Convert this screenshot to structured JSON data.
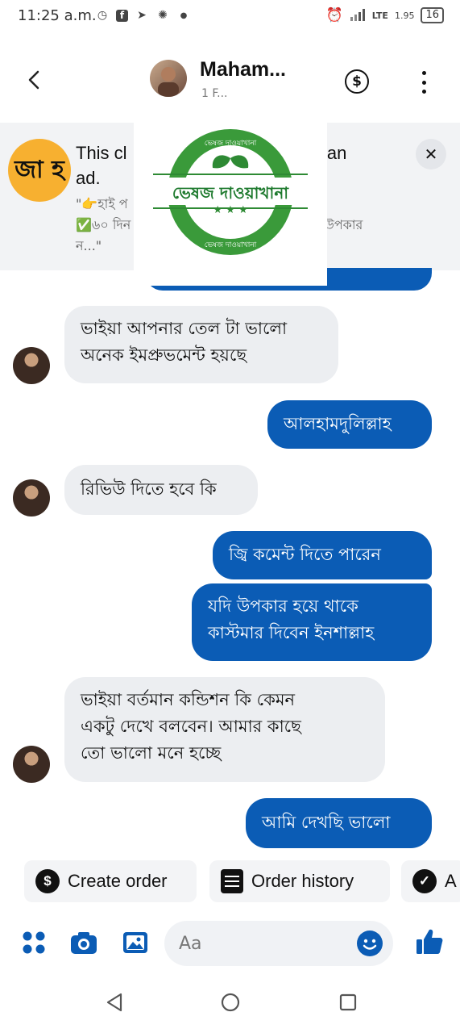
{
  "status_bar": {
    "time": "11:25 a.m.",
    "network": "LTE",
    "speed": "1.95",
    "battery": "16"
  },
  "header": {
    "contact_name": "Maham...",
    "subtitle": "1 F..."
  },
  "ad_banner": {
    "logo_text": "জা হ",
    "title": "This c[obscured] o an ad.",
    "title_left": "This cl",
    "title_right": "o an",
    "title_line2": "ad.",
    "snippet_line1": "\"👉হাই প",
    "snippet_line2": "✅৬০ দিন",
    "snippet_line2_right": "উপকার",
    "snippet_line3": "ন...\""
  },
  "overlay_logo": {
    "main_text": "ভেষজ দাওয়াখানা",
    "arc_text_top": "ভেষজ দাওয়াখানা",
    "arc_text_bottom": "ভেষজ দাওয়াখানা",
    "colors": {
      "green": "#3a9a3a",
      "dark_green": "#1e7a2e"
    }
  },
  "messages": [
    {
      "side": "in",
      "lines": [
        "ভাইয়া আপনার তেল টা ভালো",
        "অনেক ইমপ্রুভমেন্ট হয়ছে"
      ]
    },
    {
      "side": "out",
      "lines": [
        "আলহামদুলিল্লাহ"
      ]
    },
    {
      "side": "in",
      "lines": [
        "রিভিউ দিতে হবে কি"
      ]
    },
    {
      "side": "out",
      "lines": [
        "জ্বি কমেন্ট দিতে পারেন"
      ]
    },
    {
      "side": "out",
      "lines": [
        "যদি উপকার হয়ে থাকে",
        "কাস্টমার দিবেন ইনশাল্লাহ"
      ]
    },
    {
      "side": "in",
      "lines": [
        "ভাইয়া বর্তমান কন্ডিশন কি কেমন",
        "একটু দেখে  বলবেন। আমার কাছে",
        "তো ভালো মনে হচ্ছে"
      ]
    },
    {
      "side": "out",
      "lines": [
        "আমি দেখছি ভালো"
      ]
    }
  ],
  "quick_actions": [
    {
      "label": "Create order",
      "icon": "dollar-icon"
    },
    {
      "label": "Order history",
      "icon": "receipt-icon"
    },
    {
      "label": "A",
      "icon": "check-icon"
    }
  ],
  "composer": {
    "placeholder": "Aa"
  },
  "colors": {
    "accent": "#0b5cb5",
    "incoming_bubble": "#eceef1",
    "ad_bg": "#f2f3f5"
  }
}
